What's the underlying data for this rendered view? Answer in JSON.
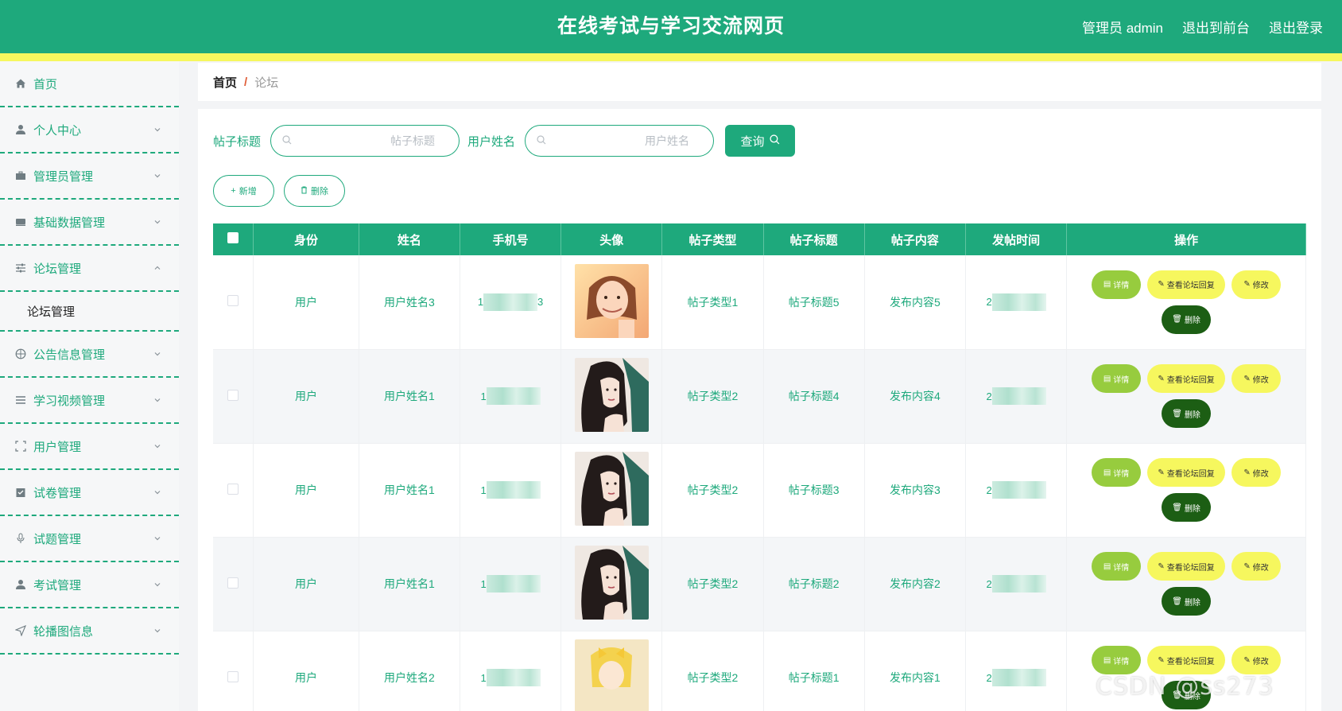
{
  "header": {
    "title": "在线考试与学习交流网页",
    "admin_label": "管理员 admin",
    "to_front": "退出到前台",
    "logout": "退出登录"
  },
  "sidebar": {
    "items": [
      {
        "label": "首页",
        "icon": "home-icon",
        "expandable": false
      },
      {
        "label": "个人中心",
        "icon": "user-icon",
        "expandable": true
      },
      {
        "label": "管理员管理",
        "icon": "briefcase-icon",
        "expandable": true
      },
      {
        "label": "基础数据管理",
        "icon": "drive-icon",
        "expandable": true
      },
      {
        "label": "论坛管理",
        "icon": "sliders-icon",
        "expandable": true,
        "expanded": true
      },
      {
        "label": "公告信息管理",
        "icon": "compass-icon",
        "expandable": true
      },
      {
        "label": "学习视频管理",
        "icon": "list-icon",
        "expandable": true
      },
      {
        "label": "用户管理",
        "icon": "frame-icon",
        "expandable": true
      },
      {
        "label": "试卷管理",
        "icon": "checklist-icon",
        "expandable": true
      },
      {
        "label": "试题管理",
        "icon": "microphone-icon",
        "expandable": true
      },
      {
        "label": "考试管理",
        "icon": "person-icon",
        "expandable": true
      },
      {
        "label": "轮播图信息",
        "icon": "send-icon",
        "expandable": true
      }
    ],
    "submenu_forum": "论坛管理"
  },
  "breadcrumb": {
    "home": "首页",
    "separator": "/",
    "current": "论坛"
  },
  "search": {
    "title_label": "帖子标题",
    "title_placeholder": "帖子标题",
    "title_value": "",
    "user_label": "用户姓名",
    "user_placeholder": "用户姓名",
    "user_value": "",
    "query_label": "查询"
  },
  "actions": {
    "add_label": "新增",
    "delete_label": "删除"
  },
  "table": {
    "headers": [
      "身份",
      "姓名",
      "手机号",
      "头像",
      "帖子类型",
      "帖子标题",
      "帖子内容",
      "发帖时间",
      "操作"
    ],
    "rows": [
      {
        "role": "用户",
        "name": "用户姓名3",
        "phone_prefix": "1",
        "phone_suffix": "3",
        "type": "帖子类型1",
        "title": "帖子标题5",
        "content": "发布内容5",
        "time_prefix": "2",
        "avatar": "avatar-warm"
      },
      {
        "role": "用户",
        "name": "用户姓名1",
        "phone_prefix": "1",
        "phone_suffix": "",
        "type": "帖子类型2",
        "title": "帖子标题4",
        "content": "发布内容4",
        "time_prefix": "2",
        "avatar": "avatar-ink"
      },
      {
        "role": "用户",
        "name": "用户姓名1",
        "phone_prefix": "1",
        "phone_suffix": "",
        "type": "帖子类型2",
        "title": "帖子标题3",
        "content": "发布内容3",
        "time_prefix": "2",
        "avatar": "avatar-ink"
      },
      {
        "role": "用户",
        "name": "用户姓名1",
        "phone_prefix": "1",
        "phone_suffix": "",
        "type": "帖子类型2",
        "title": "帖子标题2",
        "content": "发布内容2",
        "time_prefix": "2",
        "avatar": "avatar-ink"
      },
      {
        "role": "用户",
        "name": "用户姓名2",
        "phone_prefix": "1",
        "phone_suffix": "",
        "type": "帖子类型2",
        "title": "帖子标题1",
        "content": "发布内容1",
        "time_prefix": "2",
        "avatar": "avatar-yellow"
      }
    ],
    "op_labels": {
      "detail": "详情",
      "reply": "查看论坛回复",
      "edit": "修改",
      "delete": "删除"
    }
  },
  "watermark": "CSDN @ss273",
  "colors": {
    "primary": "#1ea97c",
    "stripe": "#f6f75e",
    "detail_btn": "#97cc3e",
    "delete_btn": "#1c5e14"
  }
}
